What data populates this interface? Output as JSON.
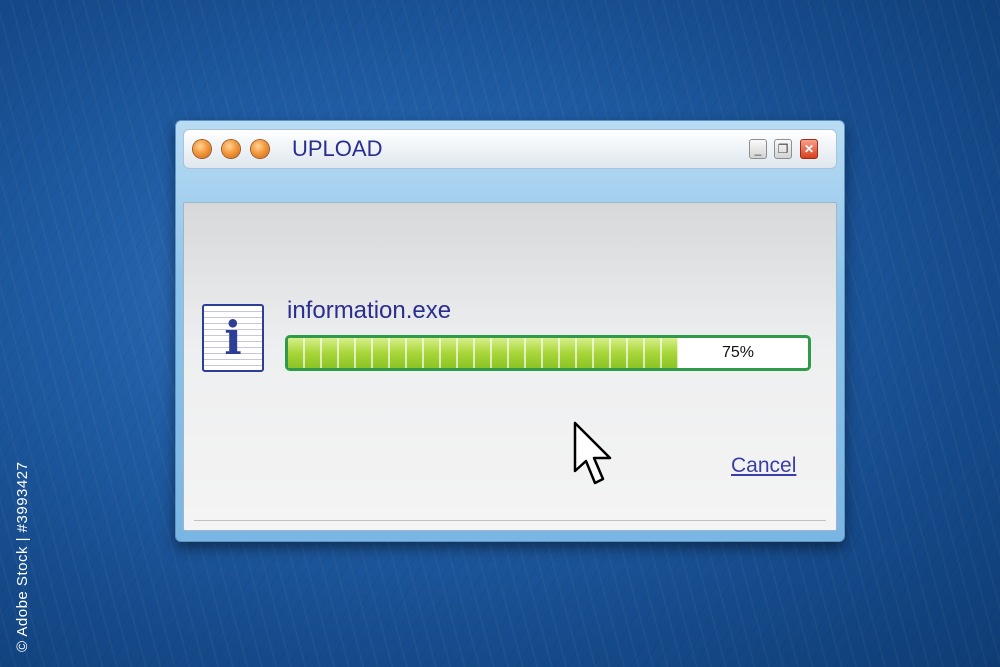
{
  "window": {
    "title": "UPLOAD",
    "controls": {
      "minimize": "_",
      "restore": "❐",
      "close": "✕"
    }
  },
  "content": {
    "icon": "info-icon",
    "icon_glyph": "i",
    "filename": "information.exe",
    "progress": {
      "value": 0.75,
      "label": "75%"
    },
    "cancel_label": "Cancel"
  },
  "side_credit": "© Adobe Stock | #3993427",
  "colors": {
    "accent": "#2a2f8f",
    "progress_fill": "#a8d63a",
    "progress_border": "#2f9a4a",
    "window_frame": "#8cc3ea",
    "background": "#215ea6"
  }
}
